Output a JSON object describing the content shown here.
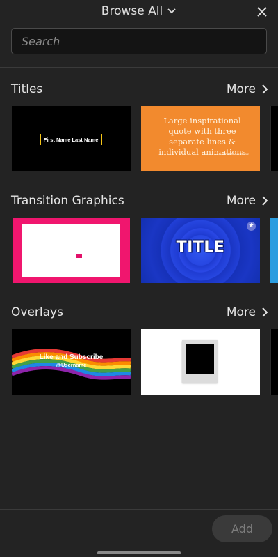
{
  "header": {
    "title": "Browse All",
    "dropdown_icon": "chevron-down-icon",
    "close_icon": "close-icon"
  },
  "search": {
    "placeholder": "Search",
    "value": ""
  },
  "sections": [
    {
      "title": "Titles",
      "more_label": "More",
      "items": [
        {
          "name": "First Name Last Name",
          "caption": "First Name Last Name"
        },
        {
          "name": "Large inspirational quote",
          "caption": "Large inspirational quote with three separate lines & individual animations",
          "author": "~ Said B.Y. Famous"
        }
      ]
    },
    {
      "title": "Transition Graphics",
      "more_label": "More",
      "items": [
        {
          "name": "pink frame"
        },
        {
          "name": "TITLE",
          "caption": "TITLE",
          "badge_icon": "star-icon"
        }
      ]
    },
    {
      "title": "Overlays",
      "more_label": "More",
      "items": [
        {
          "name": "Like and Subscribe",
          "caption": "Like and Subscribe",
          "sub_caption": "@Username"
        },
        {
          "name": "polaroid"
        }
      ]
    }
  ],
  "footer": {
    "add_label": "Add"
  },
  "colors": {
    "background": "#232323",
    "search_bg": "#141414",
    "quote_orange": "#f28a2e",
    "pink": "#f0166e",
    "blue": "#1e3bd0",
    "add_disabled": "#3a3a3a"
  }
}
